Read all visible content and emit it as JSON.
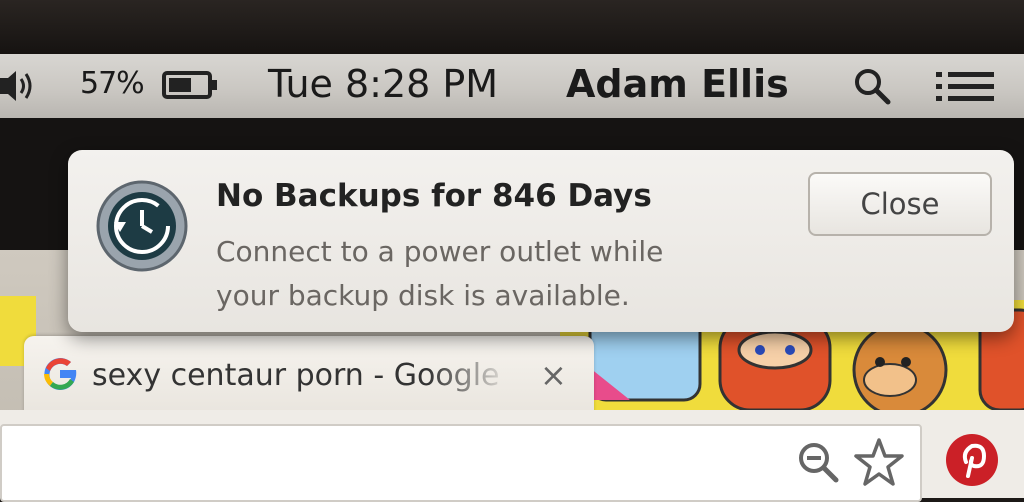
{
  "menubar": {
    "battery_percent": "57%",
    "clock": "Tue 8:28 PM",
    "user": "Adam Ellis",
    "icons": [
      "volume-icon",
      "battery-icon",
      "spotlight-search-icon",
      "notification-center-icon"
    ]
  },
  "notification": {
    "title": "No Backups for 846 Days",
    "body_line1": "Connect to a power outlet while",
    "body_line2": "your backup disk is available.",
    "close_label": "Close",
    "icon": "time-machine-icon"
  },
  "browser": {
    "tab_title": "sexy centaur porn - Google",
    "tab_close": "×",
    "toolbar_icons": [
      "zoom-icon",
      "bookmark-star-icon",
      "pinterest-icon"
    ]
  },
  "colors": {
    "menubar": "#cfccc7",
    "doodle": "#f0dc3c",
    "pinterest": "#cb2027",
    "google_blue": "#4285f4"
  }
}
